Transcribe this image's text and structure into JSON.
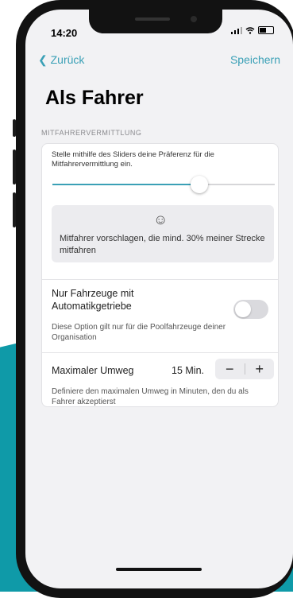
{
  "status_bar": {
    "time": "14:20",
    "signal_icon": "signal-bars-icon",
    "wifi_icon": "wifi-icon",
    "battery_icon": "battery-icon"
  },
  "nav": {
    "back_label": "Zurück",
    "save_label": "Speichern"
  },
  "page": {
    "title": "Als Fahrer"
  },
  "section": {
    "label": "MITFAHRERVERMITTLUNG",
    "slider": {
      "description": "Stelle mithilfe des Sliders deine Präferenz für die Mitfahrervermittlung ein.",
      "value_fraction": 0.66
    },
    "preference": {
      "icon": "smiley-icon",
      "text": "Mitfahrer vorschlagen, die mind. 30% meiner Strecke mitfahren"
    },
    "automatic": {
      "label": "Nur Fahrzeuge mit Automatikgetriebe",
      "enabled": false,
      "description": "Diese Option gilt nur für die Poolfahrzeuge deiner Organisation"
    },
    "detour": {
      "label": "Maximaler Umweg",
      "value": "15 Min.",
      "minus_label": "−",
      "plus_label": "+",
      "description": "Definiere den maximalen Umweg in Minuten, den du als Fahrer akzeptierst"
    }
  },
  "colors": {
    "accent": "#3aa0b6",
    "background_teal": "#0f9aa8"
  }
}
